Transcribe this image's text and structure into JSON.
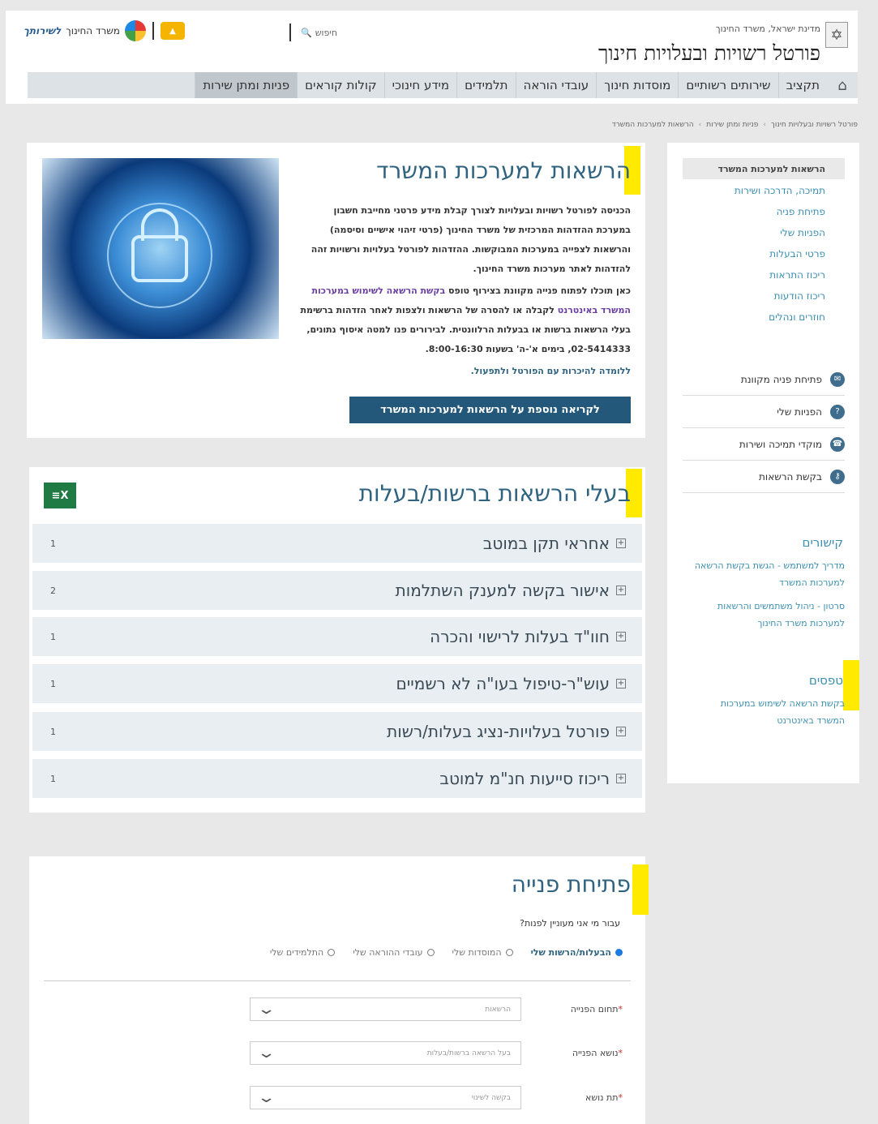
{
  "header": {
    "ministry_small": "מדינת ישראל, משרד החינוך",
    "portal_title": "פורטל רשויות ובעלויות חינוך",
    "search_placeholder": "חיפוש",
    "logo_text": "משרד החינוך",
    "logo_brand": "לשירותך"
  },
  "nav": {
    "items": [
      "תקציב",
      "שירותים רשותיים",
      "מוסדות חינוך",
      "עובדי הוראה",
      "תלמידים",
      "מידע חינוכי",
      "קולות קוראים",
      "פניות ומתן שירות"
    ]
  },
  "breadcrumb": [
    "פורטל רשויות ובעלויות חינוך",
    "פניות ומתן שירות",
    "הרשאות למערכות המשרד"
  ],
  "sidebar": {
    "active": "הרשאות למערכות המשרד",
    "links": [
      "תמיכה, הדרכה ושירות",
      "פתיחת פניה",
      "הפניות שלי",
      "פרטי הבעלות",
      "ריכוז התראות",
      "ריכוז הודעות",
      "חוזרים ונהלים"
    ],
    "actions": [
      {
        "label": "פתיחת פניה מקוונת",
        "icon": "chat-icon"
      },
      {
        "label": "הפניות שלי",
        "icon": "inquiry-icon"
      },
      {
        "label": "מוקדי תמיכה ושירות",
        "icon": "support-icon"
      },
      {
        "label": "בקשת הרשאות",
        "icon": "key-icon"
      }
    ],
    "links_heading": "קישורים",
    "links_items": [
      "מדריך למשתמש - הגשת בקשת הרשאה למערכות המשרד",
      "סרטון - ניהול משתמשים והרשאות למערכות משרד החינוך"
    ],
    "forms_heading": "טפסים",
    "forms_items": [
      "בקשת הרשאה לשימוש במערכות המשרד באינטרנט"
    ]
  },
  "card1": {
    "title": "הרשאות למערכות המשרד",
    "p1": "הכניסה לפורטל רשויות ובעלויות לצורך קבלת מידע פרטני מחייבת חשבון במערכת ההזדהות המרכזית של משרד החינוך (פרטי זיהוי אישיים וסיסמה) והרשאות לצפייה במערכות המבוקשות. ההזדהות לפורטל בעלויות ורשויות זהה להזדהות לאתר מערכות משרד החינוך.",
    "p2_a": "כאן תוכלו לפתוח פנייה מקוונת בצירוף טופס ",
    "p2_link": "בקשת הרשאה לשימוש במערכות המשרד באינטרנט",
    "p2_b": " לקבלה או להסרה של הרשאות ולצפות לאחר הזדהות ברשימת בעלי הרשאות ברשות או בבעלות הרלוונטית. לבירורים פנו למטה איסוף נתונים, 02-5414333, בימים א'-ה' בשעות 8:00-16:30.",
    "p3_link": "ללומדה להיכרות עם הפורטל ולתפעול.",
    "cta": "לקריאה נוספת על הרשאות למערכות המשרד"
  },
  "card2": {
    "title": "בעלי הרשאות ברשות/בעלות",
    "excel_icon": "excel-icon",
    "rows": [
      {
        "label": "אחראי תקן במוטב",
        "count": "1"
      },
      {
        "label": "אישור בקשה למענק השתלמות",
        "count": "2"
      },
      {
        "label": "חוו\"ד בעלות לרישוי והכרה",
        "count": "1"
      },
      {
        "label": "עוש\"ר-טיפול בעו\"ה לא רשמיים",
        "count": "1"
      },
      {
        "label": "פורטל בעלויות-נציג בעלות/רשות",
        "count": "1"
      },
      {
        "label": "ריכוז סייעות חנ\"מ למוטב",
        "count": "1"
      }
    ]
  },
  "card3": {
    "title": "פתיחת פנייה",
    "question": "עבור מי אני מעוניין לפנות?",
    "radios": [
      {
        "label": "הבעלות/הרשות שלי",
        "selected": true
      },
      {
        "label": "המוסדות שלי",
        "selected": false
      },
      {
        "label": "עובדי ההוראה שלי",
        "selected": false
      },
      {
        "label": "התלמידים שלי",
        "selected": false
      }
    ],
    "fields": [
      {
        "label": "תחום הפנייה",
        "value": "הרשאות"
      },
      {
        "label": "נושא הפנייה",
        "value": "בעל הרשאה ברשות/בעלות"
      },
      {
        "label": "תת נושא",
        "value": "בקשה לשינוי"
      }
    ]
  },
  "colors": {
    "accent": "#23587a",
    "title": "#2f6380",
    "highlight": "#ffea00",
    "link": "#3b8fb0"
  }
}
